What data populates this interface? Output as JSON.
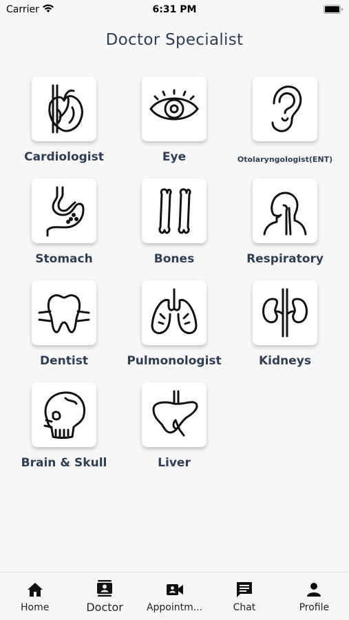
{
  "status_bar": {
    "carrier": "Carrier",
    "time": "6:31 PM"
  },
  "header": {
    "title": "Doctor Specialist"
  },
  "specialists": [
    {
      "label": "Cardiologist",
      "icon": "heart-icon"
    },
    {
      "label": "Eye",
      "icon": "eye-icon"
    },
    {
      "label": "Otolaryngologist(ENT)",
      "icon": "ear-icon"
    },
    {
      "label": "Stomach",
      "icon": "stomach-icon"
    },
    {
      "label": "Bones",
      "icon": "bones-icon"
    },
    {
      "label": "Respiratory",
      "icon": "respiratory-icon"
    },
    {
      "label": "Dentist",
      "icon": "tooth-icon"
    },
    {
      "label": "Pulmonologist",
      "icon": "lungs-icon"
    },
    {
      "label": "Kidneys",
      "icon": "kidneys-icon"
    },
    {
      "label": "Brain & Skull",
      "icon": "skull-icon"
    },
    {
      "label": "Liver",
      "icon": "liver-icon"
    }
  ],
  "tabs": [
    {
      "label": "Home",
      "icon": "home-icon",
      "active": false
    },
    {
      "label": "Doctor",
      "icon": "doctor-icon",
      "active": true
    },
    {
      "label": "Appointm...",
      "icon": "video-icon",
      "active": false
    },
    {
      "label": "Chat",
      "icon": "chat-icon",
      "active": false
    },
    {
      "label": "Profile",
      "icon": "profile-icon",
      "active": false
    }
  ]
}
